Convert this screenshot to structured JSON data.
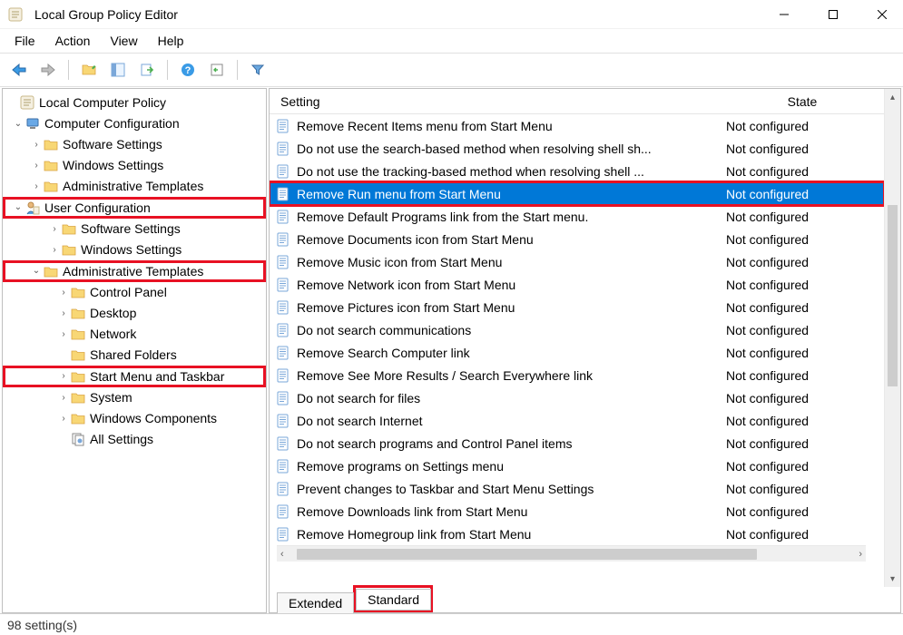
{
  "title": "Local Group Policy Editor",
  "menu": {
    "file": "File",
    "action": "Action",
    "view": "View",
    "help": "Help"
  },
  "tree": {
    "root": "Local Computer Policy",
    "cc": "Computer Configuration",
    "cc_sw": "Software Settings",
    "cc_ws": "Windows Settings",
    "cc_at": "Administrative Templates",
    "uc": "User Configuration",
    "uc_sw": "Software Settings",
    "uc_ws": "Windows Settings",
    "uc_at": "Administrative Templates",
    "uc_cp": "Control Panel",
    "uc_dk": "Desktop",
    "uc_nw": "Network",
    "uc_sf": "Shared Folders",
    "uc_sm": "Start Menu and Taskbar",
    "uc_sys": "System",
    "uc_wc": "Windows Components",
    "uc_all": "All Settings"
  },
  "columns": {
    "setting": "Setting",
    "state": "State"
  },
  "state_default": "Not configured",
  "rows": [
    {
      "name": "Remove Recent Items menu from Start Menu",
      "sel": false
    },
    {
      "name": "Do not use the search-based method when resolving shell sh...",
      "sel": false
    },
    {
      "name": "Do not use the tracking-based method when resolving shell ...",
      "sel": false
    },
    {
      "name": "Remove Run menu from Start Menu",
      "sel": true
    },
    {
      "name": "Remove Default Programs link from the Start menu.",
      "sel": false
    },
    {
      "name": "Remove Documents icon from Start Menu",
      "sel": false
    },
    {
      "name": "Remove Music icon from Start Menu",
      "sel": false
    },
    {
      "name": "Remove Network icon from Start Menu",
      "sel": false
    },
    {
      "name": "Remove Pictures icon from Start Menu",
      "sel": false
    },
    {
      "name": "Do not search communications",
      "sel": false
    },
    {
      "name": "Remove Search Computer link",
      "sel": false
    },
    {
      "name": "Remove See More Results / Search Everywhere link",
      "sel": false
    },
    {
      "name": "Do not search for files",
      "sel": false
    },
    {
      "name": "Do not search Internet",
      "sel": false
    },
    {
      "name": "Do not search programs and Control Panel items",
      "sel": false
    },
    {
      "name": "Remove programs on Settings menu",
      "sel": false
    },
    {
      "name": "Prevent changes to Taskbar and Start Menu Settings",
      "sel": false
    },
    {
      "name": "Remove Downloads link from Start Menu",
      "sel": false
    },
    {
      "name": "Remove Homegroup link from Start Menu",
      "sel": false
    }
  ],
  "tabs": {
    "extended": "Extended",
    "standard": "Standard"
  },
  "status": "98 setting(s)"
}
